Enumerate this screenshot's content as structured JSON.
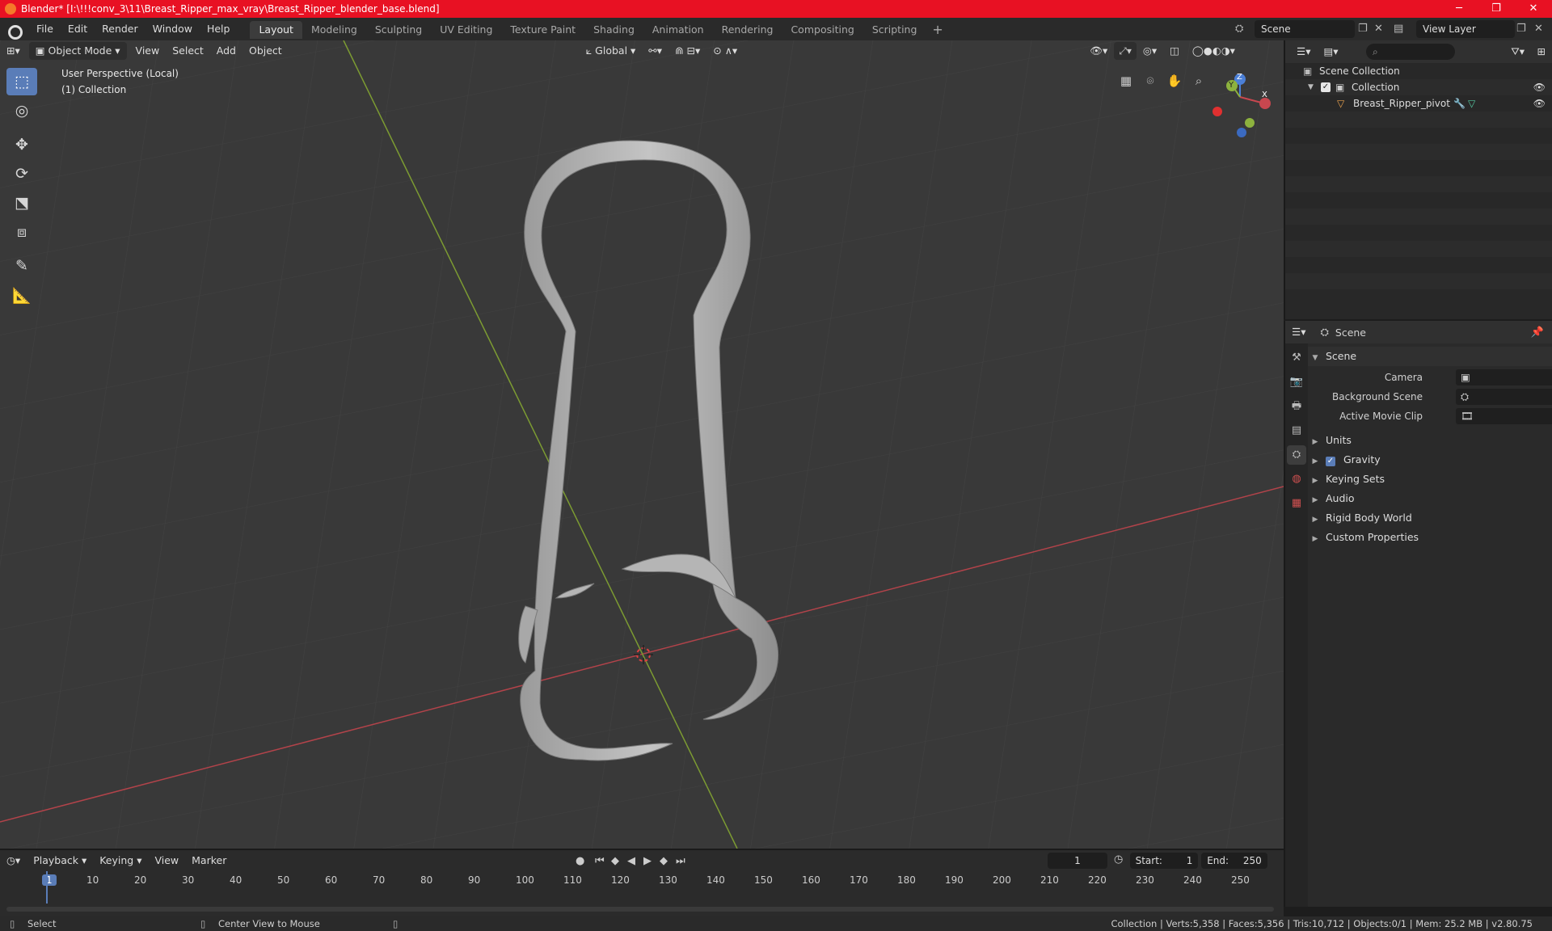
{
  "window": {
    "title": "Blender* [I:\\!!!conv_3\\11\\Breast_Ripper_max_vray\\Breast_Ripper_blender_base.blend]",
    "min_icon": "─",
    "max_icon": "❐",
    "close_icon": "✕"
  },
  "menu": [
    "File",
    "Edit",
    "Render",
    "Window",
    "Help"
  ],
  "workspaces": [
    "Layout",
    "Modeling",
    "Sculpting",
    "UV Editing",
    "Texture Paint",
    "Shading",
    "Animation",
    "Rendering",
    "Compositing",
    "Scripting"
  ],
  "active_workspace": "Layout",
  "scene_name": "Scene",
  "view_layer": "View Layer",
  "viewport": {
    "mode": "Object Mode",
    "menus": [
      "View",
      "Select",
      "Add",
      "Object"
    ],
    "transform_orientation": "Global",
    "perspective_label": "User Perspective (Local)",
    "collection_label": "(1) Collection",
    "gizmo_axes": {
      "x": "X",
      "y": "Y",
      "z": "Z"
    }
  },
  "outliner": {
    "root": "Scene Collection",
    "collection": "Collection",
    "object": "Breast_Ripper_pivot"
  },
  "properties": {
    "context": "Scene",
    "panel": "Scene",
    "camera_label": "Camera",
    "background_scene_label": "Background Scene",
    "active_movie_clip_label": "Active Movie Clip",
    "sections": [
      "Units",
      "Gravity",
      "Keying Sets",
      "Audio",
      "Rigid Body World",
      "Custom Properties"
    ],
    "gravity_checked": true
  },
  "timeline": {
    "menus": [
      "Playback",
      "Keying",
      "View",
      "Marker"
    ],
    "current_frame": "1",
    "start_label": "Start:",
    "start": "1",
    "end_label": "End:",
    "end": "250",
    "ruler": [
      "1",
      "10",
      "20",
      "30",
      "40",
      "50",
      "60",
      "70",
      "80",
      "90",
      "100",
      "110",
      "120",
      "130",
      "140",
      "150",
      "160",
      "170",
      "180",
      "190",
      "200",
      "210",
      "220",
      "230",
      "240",
      "250"
    ]
  },
  "status": {
    "select": "Select",
    "center_view": "Center View to Mouse",
    "stats": "Collection | Verts:5,358 | Faces:5,356 | Tris:10,712 | Objects:0/1 | Mem: 25.2 MB | v2.80.75"
  },
  "colors": {
    "title_bar": "#e81123",
    "active_tool": "#5a7db8",
    "x_axis": "#c8474f",
    "y_axis": "#8db23e",
    "z_axis": "#4b7fd6"
  }
}
